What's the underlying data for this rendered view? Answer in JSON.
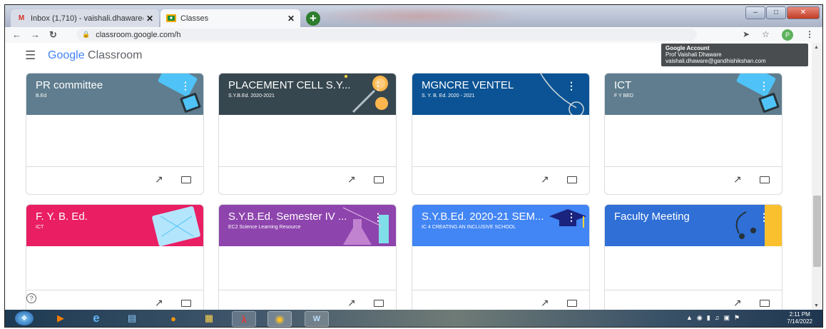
{
  "browser": {
    "tabs": [
      {
        "label": "Inbox (1,710) - vaishali.dhaware@",
        "favicon": "gmail-icon",
        "close": "✕"
      },
      {
        "label": "Classes",
        "favicon": "classroom-icon",
        "close": "✕"
      }
    ],
    "new_tab": "+",
    "url": "classroom.google.com/h",
    "profile_initial": "P"
  },
  "classroom": {
    "logo_google": "Google",
    "logo_app": " Classroom",
    "account": {
      "heading": "Google Account",
      "name": "Prof Vaishali Dhaware",
      "email": "vaishali.dhaware@gandhishikshan.com"
    }
  },
  "cards": [
    {
      "title": "PR committee",
      "subtitle": "B.Ed",
      "color": "#5f7d8e"
    },
    {
      "title": "PLACEMENT CELL S.Y...",
      "subtitle": "S.Y.B.Ed. 2020-2021",
      "color": "#37474f"
    },
    {
      "title": "MGNCRE VENTEL",
      "subtitle": "S. Y. B. Ed. 2020 - 2021",
      "color": "#0b5394"
    },
    {
      "title": "ICT",
      "subtitle": "F Y BED",
      "color": "#5f7d8e"
    },
    {
      "title": "F. Y. B. Ed.",
      "subtitle": "ICT",
      "color": "#e91e63"
    },
    {
      "title": "S.Y.B.Ed. Semester IV ...",
      "subtitle": "EC2 Science Learning Resource",
      "color": "#8e44ad"
    },
    {
      "title": "S.Y.B.Ed. 2020-21 SEM...",
      "subtitle": "IC 4 CREATING AN INCLUSIVE SCHOOL",
      "color": "#4285f4"
    },
    {
      "title": "Faculty Meeting",
      "subtitle": "",
      "color": "#2f6fd6"
    }
  ],
  "taskbar": {
    "time": "2:11 PM",
    "date": "7/14/2022"
  }
}
